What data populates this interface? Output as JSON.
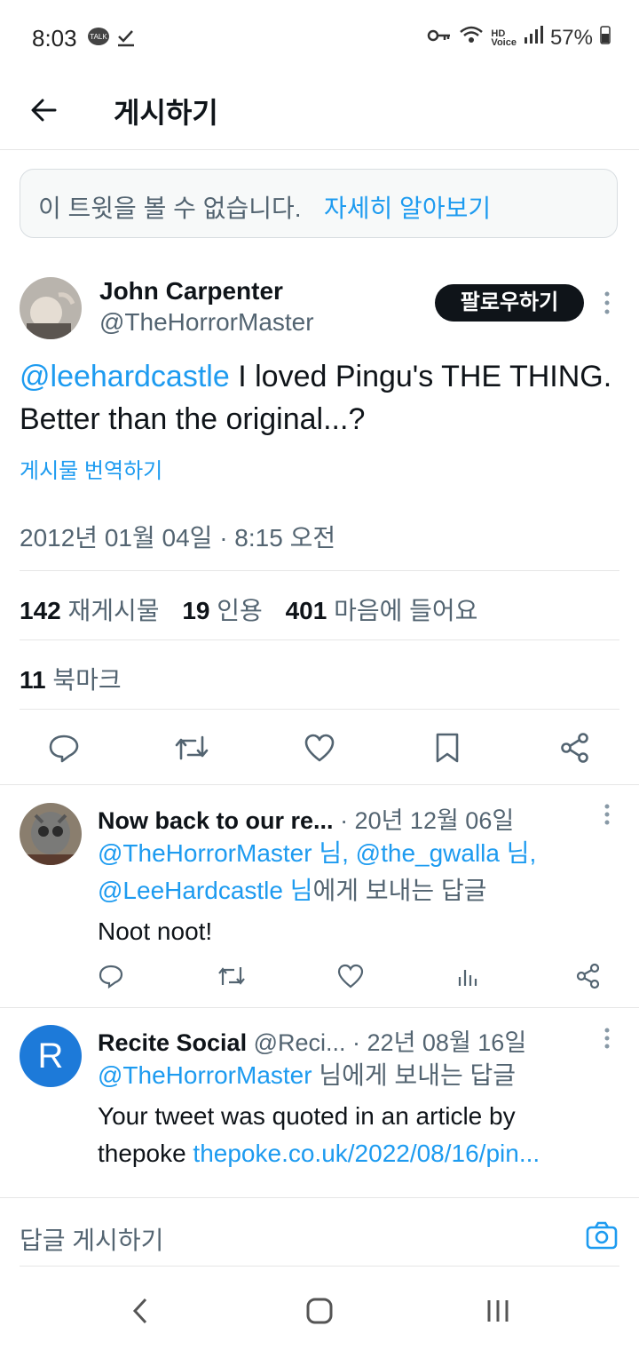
{
  "status": {
    "time": "8:03",
    "battery": "57%"
  },
  "header": {
    "title": "게시하기"
  },
  "notice": {
    "text": "이 트윗을 볼 수 없습니다.",
    "link": "자세히 알아보기"
  },
  "tweet": {
    "name": "John Carpenter",
    "handle": "@TheHorrorMaster",
    "follow_label": "팔로우하기",
    "mention": "@leehardcastle",
    "text": " I loved Pingu's THE THING. Better than the original...?",
    "translate": "게시물 번역하기",
    "date": "2012년 01월 04일 · 8:15 오전",
    "retweets": "142",
    "retweets_label": "재게시물",
    "quotes": "19",
    "quotes_label": "인용",
    "likes": "401",
    "likes_label": "마음에 들어요",
    "bookmarks": "11",
    "bookmarks_label": "북마크"
  },
  "replies": [
    {
      "name": "Now back to our re...",
      "meta": "· 20년 12월 06일",
      "to_handles": "@TheHorrorMaster 님, @the_gwalla 님,",
      "to_handles2": "@LeeHardcastle 님",
      "to_suffix": "에게 보내는 답글",
      "text": "Noot noot!"
    },
    {
      "name": "Recite Social",
      "handle": "@Reci...",
      "meta": "· 22년 08월 16일",
      "to_handles": "@TheHorrorMaster",
      "to_suffix": " 님에게 보내는 답글",
      "text1": "Your tweet was quoted in an article by",
      "text2": "thepoke ",
      "link": "thepoke.co.uk/2022/08/16/pin...",
      "avatar_letter": "R"
    }
  ],
  "compose": {
    "placeholder": "답글 게시하기"
  },
  "colors": {
    "accent": "#1d9bf0",
    "text": "#0f1419",
    "muted": "#536471"
  }
}
